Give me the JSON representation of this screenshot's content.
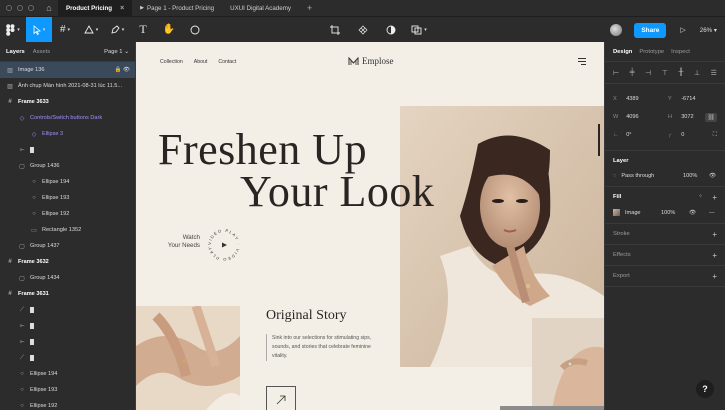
{
  "titlebar": {
    "tabs": [
      {
        "label": "Product Pricing",
        "active": true
      },
      {
        "label": "Page 1 - Product Pricing",
        "active": false
      },
      {
        "label": "UXUI Digital Academy",
        "active": false
      }
    ]
  },
  "toolbar": {
    "share_label": "Share",
    "zoom": "26%"
  },
  "left_panel": {
    "tabs": [
      "Layers",
      "Assets"
    ],
    "page": "Page 1 ⌄",
    "layers": [
      {
        "label": "Image 136",
        "icon": "▨",
        "indent": 0,
        "selected": true,
        "tail": "🔒 👁"
      },
      {
        "label": "Ảnh chụp Màn hình 2021-08-31 lúc 11.5...",
        "icon": "▨",
        "indent": 0
      },
      {
        "label": "Frame 3633",
        "icon": "#",
        "indent": 0,
        "bold": true
      },
      {
        "label": "Controls/Switch buttons Dark",
        "icon": "◇",
        "indent": 1,
        "purple": true
      },
      {
        "label": "Ellipse 3",
        "icon": "◇",
        "indent": 2,
        "purple": true
      },
      {
        "label": "",
        "icon": "⟜",
        "indent": 1,
        "bar": true
      },
      {
        "label": "Group 1436",
        "icon": "▢",
        "indent": 1
      },
      {
        "label": "Ellipse 194",
        "icon": "○",
        "indent": 2
      },
      {
        "label": "Ellipse 193",
        "icon": "○",
        "indent": 2
      },
      {
        "label": "Ellipse 192",
        "icon": "○",
        "indent": 2
      },
      {
        "label": "Rectangle 1352",
        "icon": "▭",
        "indent": 2
      },
      {
        "label": "Group 1437",
        "icon": "▢",
        "indent": 1
      },
      {
        "label": "Frame 3632",
        "icon": "#",
        "indent": 0,
        "bold": true
      },
      {
        "label": "Group 1434",
        "icon": "▢",
        "indent": 1
      },
      {
        "label": "Frame 3631",
        "icon": "#",
        "indent": 0,
        "bold": true
      },
      {
        "label": "",
        "icon": "⟋",
        "indent": 1,
        "bar": true
      },
      {
        "label": "",
        "icon": "⟜",
        "indent": 1,
        "bar": true
      },
      {
        "label": "",
        "icon": "⟜",
        "indent": 1,
        "bar": true
      },
      {
        "label": "",
        "icon": "⟋",
        "indent": 1,
        "bar": true
      },
      {
        "label": "Ellipse 194",
        "icon": "○",
        "indent": 1
      },
      {
        "label": "Ellipse 193",
        "icon": "○",
        "indent": 1
      },
      {
        "label": "Ellipse 192",
        "icon": "○",
        "indent": 1
      }
    ]
  },
  "canvas": {
    "nav": [
      "Collection",
      "About",
      "Contact"
    ],
    "brand": "Emplose",
    "hero_line1": "Freshen Up",
    "hero_line2": "Your Look",
    "watch_label_1": "Watch",
    "watch_label_2": "Your Needs",
    "circle_text": "VIDEO PLAY · VIDEO PLAY ·",
    "story_title": "Original Story",
    "story_text": "Sink into our selections for stimulating sips, sounds, and stories that celebrate feminine vitality."
  },
  "right_panel": {
    "tabs": [
      "Design",
      "Prototype",
      "Inspect"
    ],
    "x_label": "X",
    "x_value": "4389",
    "y_label": "Y",
    "y_value": "-6714",
    "w_label": "W",
    "w_value": "4096",
    "h_label": "H",
    "h_value": "3072",
    "r_value": "0°",
    "radius_value": "0",
    "layer_title": "Layer",
    "blend": "Pass through",
    "opacity": "100%",
    "fill_title": "Fill",
    "fill_type": "Image",
    "fill_opacity": "100%",
    "stroke_title": "Stroke",
    "effects_title": "Effects",
    "export_title": "Export"
  },
  "colors": {
    "accent": "#0d99ff",
    "canvas_bg": "#f3efe6",
    "panel_bg": "#2c2c2c",
    "component_purple": "#a48bff"
  }
}
